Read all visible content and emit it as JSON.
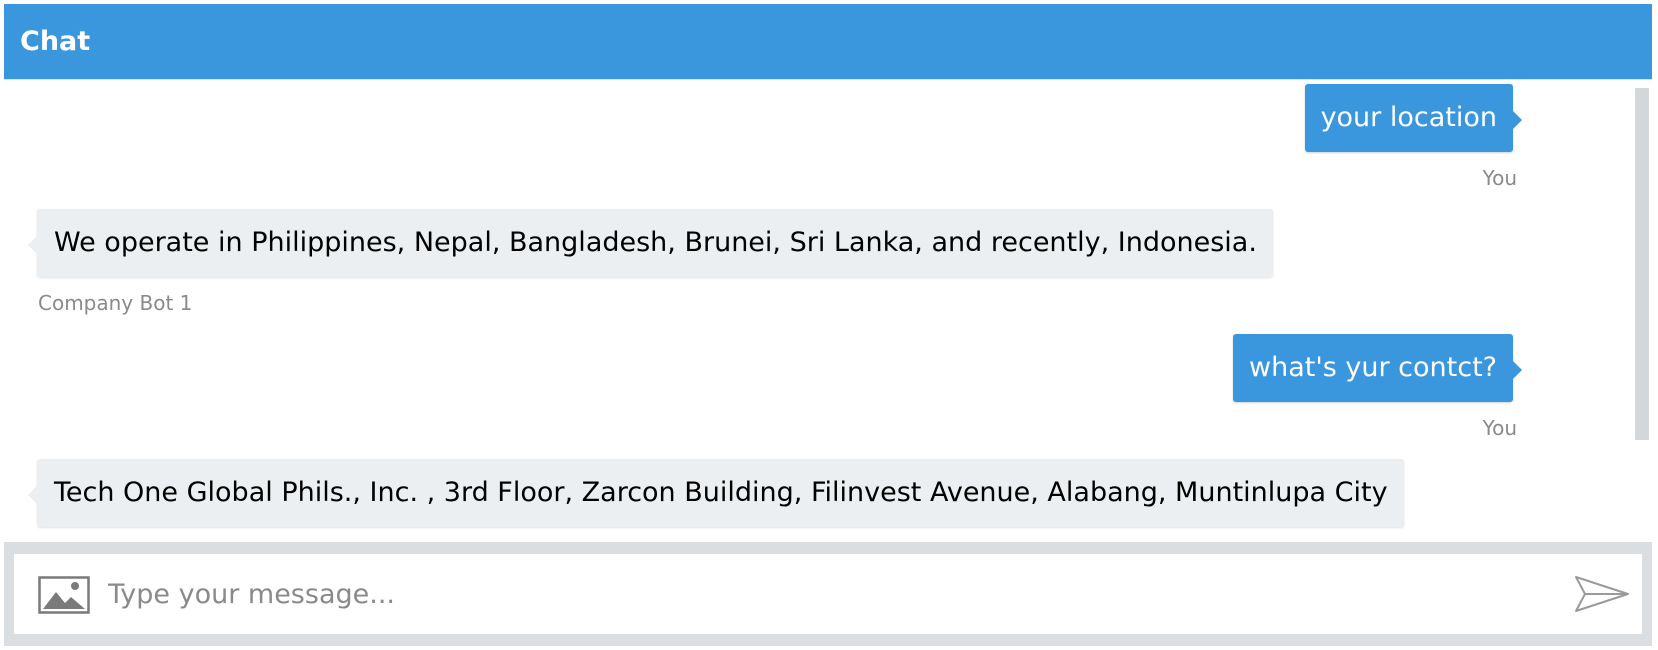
{
  "header": {
    "title": "Chat"
  },
  "messages": [
    {
      "from": "user",
      "text": "your location",
      "sender": "You"
    },
    {
      "from": "bot",
      "text": "We operate in Philippines, Nepal, Bangladesh, Brunei, Sri Lanka, and recently, Indonesia.",
      "sender": "Company Bot 1"
    },
    {
      "from": "user",
      "text": "what's yur contct?",
      "sender": "You"
    },
    {
      "from": "bot",
      "text": "Tech One Global Phils., Inc. , 3rd Floor, Zarcon Building, Filinvest Avenue, Alabang, Muntinlupa City",
      "sender": ""
    }
  ],
  "input": {
    "placeholder": "Type your message...",
    "value": ""
  },
  "icons": {
    "upload": "image-upload-icon",
    "send": "send-icon"
  },
  "colors": {
    "accent": "#3a96dd",
    "bot_bubble": "#eceff1",
    "input_area": "#dbdee1",
    "sender_text": "#8a8a8a"
  }
}
